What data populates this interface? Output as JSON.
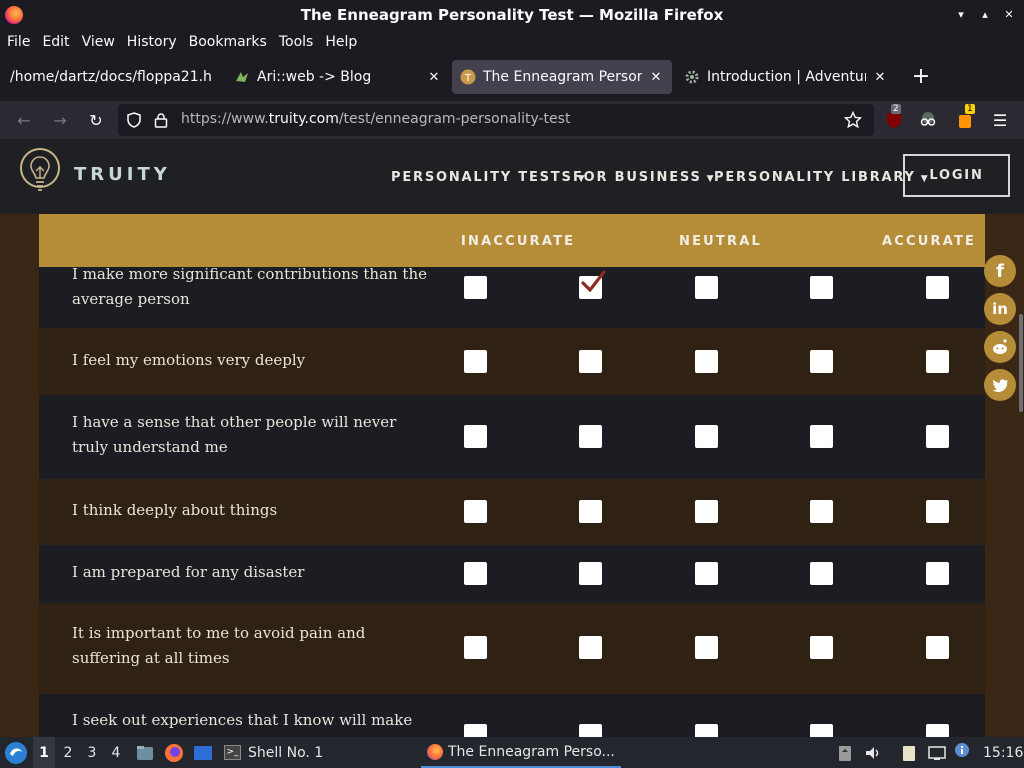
{
  "window": {
    "title": "The Enneagram Personality Test — Mozilla Firefox",
    "controls": [
      "▾",
      "▴",
      "✕"
    ]
  },
  "menubar": {
    "items": [
      "File",
      "Edit",
      "View",
      "History",
      "Bookmarks",
      "Tools",
      "Help"
    ]
  },
  "tabs": [
    {
      "label": "/home/dartz/docs/floppa21.h",
      "active": false
    },
    {
      "label": "Ari::web -> Blog",
      "active": false
    },
    {
      "label": "The Enneagram Personal",
      "active": true
    },
    {
      "label": "Introduction | Adventure",
      "active": false
    }
  ],
  "toolbar": {
    "url_prefix": "https://www.",
    "url_domain": "truity.com",
    "url_path": "/test/enneagram-personality-test",
    "ublock_count": "2",
    "ext_badge": "1"
  },
  "site": {
    "brand": "TRUITY",
    "nav": [
      "PERSONALITY TESTS",
      "FOR BUSINESS",
      "PERSONALITY LIBRARY"
    ],
    "login": "LOGIN",
    "accent_color": "#b58d38"
  },
  "scale": {
    "labels": [
      "INACCURATE",
      "NEUTRAL",
      "ACCURATE"
    ]
  },
  "questions": [
    {
      "text": "I make more significant contributions than the average person",
      "selected": 1
    },
    {
      "text": "I feel my emotions very deeply",
      "selected": null
    },
    {
      "text": "I have a sense that other people will never truly understand me",
      "selected": null
    },
    {
      "text": "I think deeply about things",
      "selected": null
    },
    {
      "text": "I am prepared for any disaster",
      "selected": null
    },
    {
      "text": "It is important to me to avoid pain and suffering at all times",
      "selected": null
    },
    {
      "text": "I seek out experiences that I know will make me feel",
      "selected": null
    }
  ],
  "share": [
    "f",
    "in",
    "reddit",
    "twitter"
  ],
  "taskbar": {
    "workspaces": [
      "1",
      "2",
      "3",
      "4"
    ],
    "current_workspace": "1",
    "shell_label": "Shell No. 1",
    "firefox_label": "The Enneagram Perso...",
    "clock": "15:16"
  }
}
